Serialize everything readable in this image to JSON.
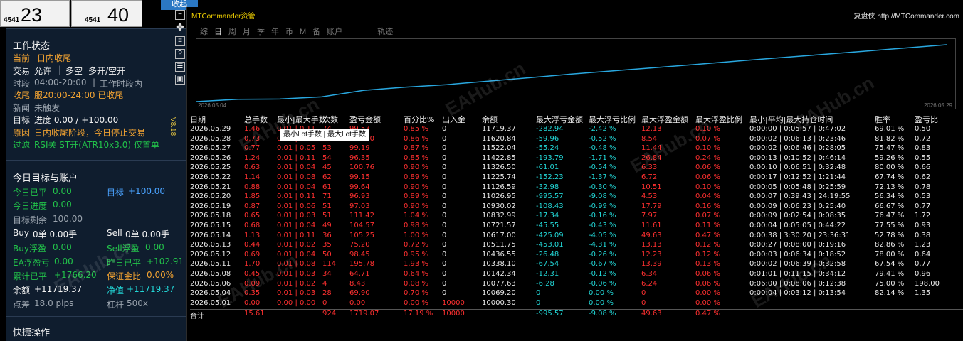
{
  "price_boxes": [
    {
      "small": "4541",
      "big": "23"
    },
    {
      "small": "4541",
      "big": "40"
    }
  ],
  "collapse_label": "收起",
  "panel": {
    "status_title": "工作状态",
    "current_label": "当前",
    "current_value": "日内收尾",
    "trade_label": "交易",
    "trade_allow": "允许",
    "trade_dir": "多空",
    "trade_mode": "多开/空开",
    "period_label": "时段",
    "period_value": "04:00-20:00",
    "period_status": "工作时段内",
    "close_label": "收尾",
    "close_value": "服20:00-24:00 已收尾",
    "news_label": "新闻",
    "news_value": "未触发",
    "target_label": "目标",
    "target_value": "进度 0.00 / +100.00",
    "reason_label": "原因",
    "reason_value": "日内收尾阶段，今日停止交易",
    "filter_label": "过滤",
    "filter_value": "RSI关  ST开(ATR10x3.0)  仅首单",
    "version": "V8.18",
    "today_title": "今日目标与账户",
    "today_closed_label": "今日已平",
    "today_closed_value": "0.00",
    "target2_label": "目标",
    "target2_value": "+100.00",
    "today_progress_label": "今日进度",
    "today_progress_value": "0.00",
    "remain_label": "目标剩余",
    "remain_value": "100.00",
    "buy_label": "Buy",
    "buy_value": "0单  0.00手",
    "sell_label": "Sell",
    "sell_value": "0单  0.00手",
    "buy_float_label": "Buy浮盈",
    "buy_float_value": "0.00",
    "sell_float_label": "Sell浮盈",
    "sell_float_value": "0.00",
    "ea_float_label": "EA浮盈亏",
    "ea_float_value": "0.00",
    "yest_label": "昨日已平",
    "yest_value": "+102.91",
    "cum_label": "累计已平",
    "cum_value": "+1766.20",
    "margin_label": "保证金比",
    "margin_value": "0.00%",
    "balance_label": "余额",
    "balance_value": "+11719.37",
    "equity_label": "净值",
    "equity_value": "+11719.37",
    "spread_label": "点差",
    "spread_value": "18.0 pips",
    "leverage_label": "杠杆",
    "leverage_value": "500x",
    "quick_title": "快捷操作"
  },
  "icons": [
    "minus-icon",
    "move-icon",
    "doc-icon",
    "help-icon",
    "list-icon",
    "save-icon"
  ],
  "chart": {
    "app_title": "MTCommander资管",
    "author": "复盘侠 http://MTCommander.com",
    "tabs": [
      "综",
      "日",
      "周",
      "月",
      "季",
      "年",
      "币",
      "M",
      "备",
      "账户",
      "轨迹"
    ],
    "active_tab": 1,
    "date_start": "2026.05.04",
    "date_end": "2026.05.29"
  },
  "tooltip": "最小Lot手数 | 最大Lot手数",
  "table": {
    "headers": [
      "日期",
      "总手数",
      "最小|最大手数",
      "次数",
      "盈亏金额",
      "百分比%",
      "出入金",
      "余额",
      "最大浮亏金额",
      "最大浮亏比例",
      "最大浮盈金额",
      "最大浮盈比例",
      "最小|平均|最大持仓时间",
      "胜率",
      "盈亏比"
    ],
    "rows": [
      [
        "2026.05.29",
        "1.46",
        "0.01 | 0.11",
        "74",
        "99.53",
        "0.85 %",
        "0",
        "11719.37",
        "-282.94",
        "-2.42 %",
        "12.13",
        "0.10 %",
        "0:00:00 | 0:05:57 | 0:47:02",
        "69.01 %",
        "0.50"
      ],
      [
        "2026.05.28",
        "0.73",
        "0.01 | 0.05",
        "54",
        "100.70",
        "0.86 %",
        "0",
        "11620.84",
        "-59.96",
        "-0.52 %",
        "8.54",
        "0.07 %",
        "0:00:02 | 0:06:13 | 0:23:46",
        "81.82 %",
        "0.72"
      ],
      [
        "2026.05.27",
        "0.77",
        "0.01 | 0.05",
        "53",
        "99.19",
        "0.87 %",
        "0",
        "11522.04",
        "-55.24",
        "-0.48 %",
        "11.44",
        "0.10 %",
        "0:00:02 | 0:06:46 | 0:28:05",
        "75.47 %",
        "0.83"
      ],
      [
        "2026.05.26",
        "1.24",
        "0.01 | 0.11",
        "54",
        "96.35",
        "0.85 %",
        "0",
        "11422.85",
        "-193.79",
        "-1.71 %",
        "26.84",
        "0.24 %",
        "0:00:13 | 0:10:52 | 0:46:14",
        "59.26 %",
        "0.55"
      ],
      [
        "2026.05.25",
        "0.63",
        "0.01 | 0.04",
        "45",
        "100.76",
        "0.90 %",
        "0",
        "11326.50",
        "-61.01",
        "-0.54 %",
        "6.33",
        "0.06 %",
        "0:00:10 | 0:06:51 | 0:32:48",
        "80.00 %",
        "0.66"
      ],
      [
        "2026.05.22",
        "1.14",
        "0.01 | 0.08",
        "62",
        "99.15",
        "0.89 %",
        "0",
        "11225.74",
        "-152.23",
        "-1.37 %",
        "6.72",
        "0.06 %",
        "0:00:17 | 0:12:52 | 1:21:44",
        "67.74 %",
        "0.62"
      ],
      [
        "2026.05.21",
        "0.88",
        "0.01 | 0.04",
        "61",
        "99.64",
        "0.90 %",
        "0",
        "11126.59",
        "-32.98",
        "-0.30 %",
        "10.51",
        "0.10 %",
        "0:00:05 | 0:05:48 | 0:25:59",
        "72.13 %",
        "0.78"
      ],
      [
        "2026.05.20",
        "1.85",
        "0.01 | 0.11",
        "71",
        "96.93",
        "0.89 %",
        "0",
        "11026.95",
        "-995.57",
        "-9.08 %",
        "4.53",
        "0.04 %",
        "0:00:07 | 0:39:43 | 24:19:55",
        "56.34 %",
        "0.53"
      ],
      [
        "2026.05.19",
        "0.87",
        "0.01 | 0.06",
        "51",
        "97.03",
        "0.90 %",
        "0",
        "10930.02",
        "-108.43",
        "-0.99 %",
        "17.79",
        "0.16 %",
        "0:00:09 | 0:06:23 | 0:25:40",
        "66.67 %",
        "0.77"
      ],
      [
        "2026.05.18",
        "0.65",
        "0.01 | 0.03",
        "51",
        "111.42",
        "1.04 %",
        "0",
        "10832.99",
        "-17.34",
        "-0.16 %",
        "7.97",
        "0.07 %",
        "0:00:09 | 0:02:54 | 0:08:35",
        "76.47 %",
        "1.72"
      ],
      [
        "2026.05.15",
        "0.68",
        "0.01 | 0.04",
        "49",
        "104.57",
        "0.98 %",
        "0",
        "10721.57",
        "-45.55",
        "-0.43 %",
        "11.61",
        "0.11 %",
        "0:00:04 | 0:05:05 | 0:44:22",
        "77.55 %",
        "0.93"
      ],
      [
        "2026.05.14",
        "1.13",
        "0.01 | 0.11",
        "36",
        "105.25",
        "1.00 %",
        "0",
        "10617.00",
        "-425.09",
        "-4.05 %",
        "49.63",
        "0.47 %",
        "0:00:38 | 3:30:20 | 23:36:31",
        "52.78 %",
        "0.38"
      ],
      [
        "2026.05.13",
        "0.44",
        "0.01 | 0.02",
        "35",
        "75.20",
        "0.72 %",
        "0",
        "10511.75",
        "-453.01",
        "-4.31 %",
        "13.13",
        "0.12 %",
        "0:00:27 | 0:08:00 | 0:19:16",
        "82.86 %",
        "1.23"
      ],
      [
        "2026.05.12",
        "0.69",
        "0.01 | 0.04",
        "50",
        "98.45",
        "0.95 %",
        "0",
        "10436.55",
        "-26.48",
        "-0.26 %",
        "12.23",
        "0.12 %",
        "0:00:03 | 0:06:34 | 0:18:52",
        "78.00 %",
        "0.64"
      ],
      [
        "2026.05.11",
        "1.70",
        "0.01 | 0.08",
        "114",
        "195.78",
        "1.93 %",
        "0",
        "10338.10",
        "-67.54",
        "-0.67 %",
        "13.39",
        "0.13 %",
        "0:00:02 | 0:06:39 | 0:32:58",
        "67.54 %",
        "0.77"
      ],
      [
        "2026.05.08",
        "0.45",
        "0.01 | 0.03",
        "34",
        "64.71",
        "0.64 %",
        "0",
        "10142.34",
        "-12.31",
        "-0.12 %",
        "6.34",
        "0.06 %",
        "0:01:01 | 0:11:15 | 0:34:12",
        "79.41 %",
        "0.96"
      ],
      [
        "2026.05.06",
        "0.09",
        "0.01 | 0.02",
        "4",
        "8.43",
        "0.08 %",
        "0",
        "10077.63",
        "-6.28",
        "-0.06 %",
        "6.24",
        "0.06 %",
        "0:06:00 | 0:08:06 | 0:12:38",
        "75.00 %",
        "198.00"
      ],
      [
        "2026.05.04",
        "0.35",
        "0.01 | 0.03",
        "28",
        "69.90",
        "0.70 %",
        "0",
        "10069.20",
        "0",
        "0.00 %",
        "0",
        "0.00 %",
        "0:00:04 | 0:03:12 | 0:13:54",
        "82.14 %",
        "1.35"
      ],
      [
        "2026.05.01",
        "0.00",
        "0.00 | 0.00",
        "0",
        "0.00",
        "0.00 %",
        "10000",
        "10000.30",
        "0",
        "0.00 %",
        "0",
        "0.00 %",
        "",
        "",
        ""
      ]
    ],
    "summary": [
      "合计",
      "15.61",
      "",
      "924",
      "1719.07",
      "17.19 %",
      "10000",
      "",
      "-995.57",
      "-9.08 %",
      "49.63",
      "0.47 %",
      "",
      "",
      ""
    ]
  },
  "equity_curve": [
    10000,
    10069,
    10078,
    10142,
    10338,
    10437,
    10512,
    10617,
    10722,
    10833,
    10930,
    11027,
    11127,
    11226,
    11327,
    11423,
    11522,
    11621,
    11719
  ],
  "colors": {
    "accent": "#2b78c4",
    "curve": "#29a8e0",
    "title": "#f0d000",
    "panel": "#0f1d2e"
  },
  "watermark": "EAHub.cn"
}
